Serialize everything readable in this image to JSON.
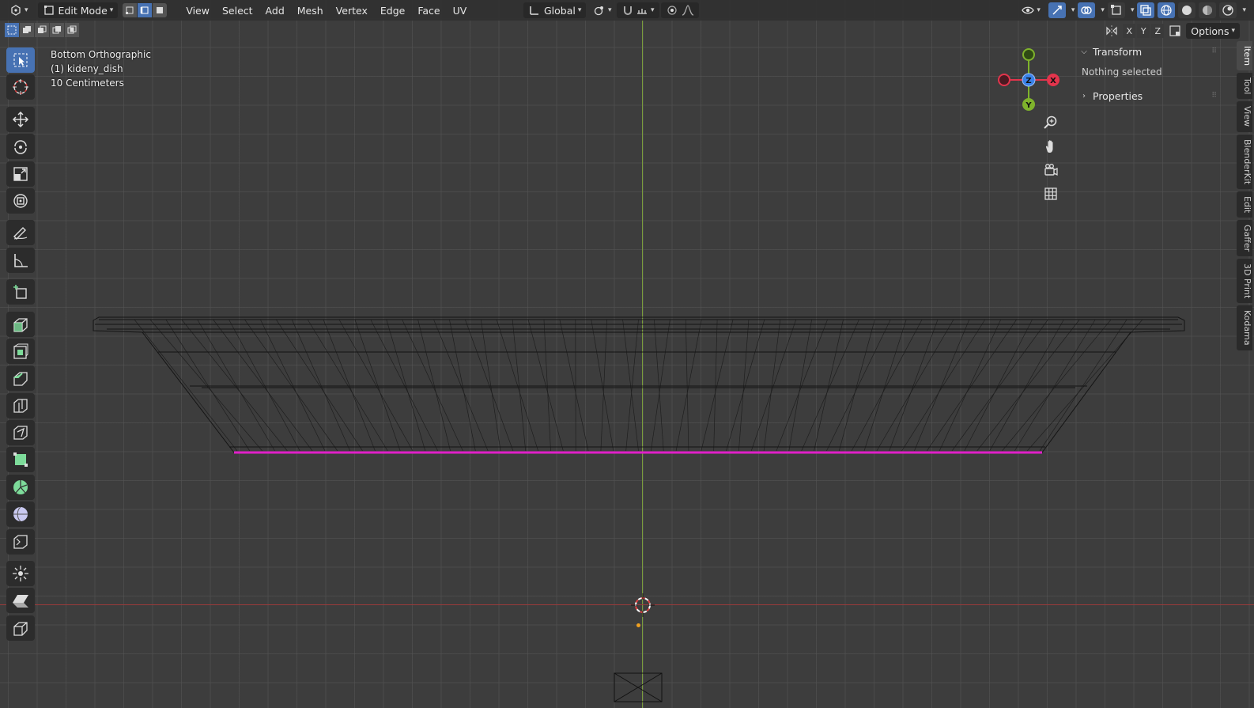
{
  "header": {
    "mode_label": "Edit Mode",
    "menus": [
      "View",
      "Select",
      "Add",
      "Mesh",
      "Vertex",
      "Edge",
      "Face",
      "UV"
    ],
    "orientation_label": "Global"
  },
  "viewport": {
    "view_name": "Bottom Orthographic",
    "object_name": "(1) kideny_dish",
    "scale_label": "10 Centimeters"
  },
  "gizmo": {
    "x_label": "X",
    "y_label": "Y",
    "z_label": "Z",
    "x_color": "#e3344c",
    "y_color": "#7fb32c",
    "z_color": "#3b82e8"
  },
  "sidebar": {
    "options_label": "Options",
    "axis_toggles": [
      "X",
      "Y",
      "Z"
    ],
    "transform_label": "Transform",
    "nothing_selected": "Nothing selected",
    "properties_label": "Properties",
    "tabs": [
      "Item",
      "Tool",
      "View",
      "BlenderKit",
      "Edit",
      "Gaffer",
      "3D Print",
      "Kodama"
    ]
  },
  "colors": {
    "accent": "#4772b3",
    "selected_edge": "#e020c8",
    "x_axis_line": "#a83a3a",
    "y_axis_line": "#6f9a2e"
  }
}
